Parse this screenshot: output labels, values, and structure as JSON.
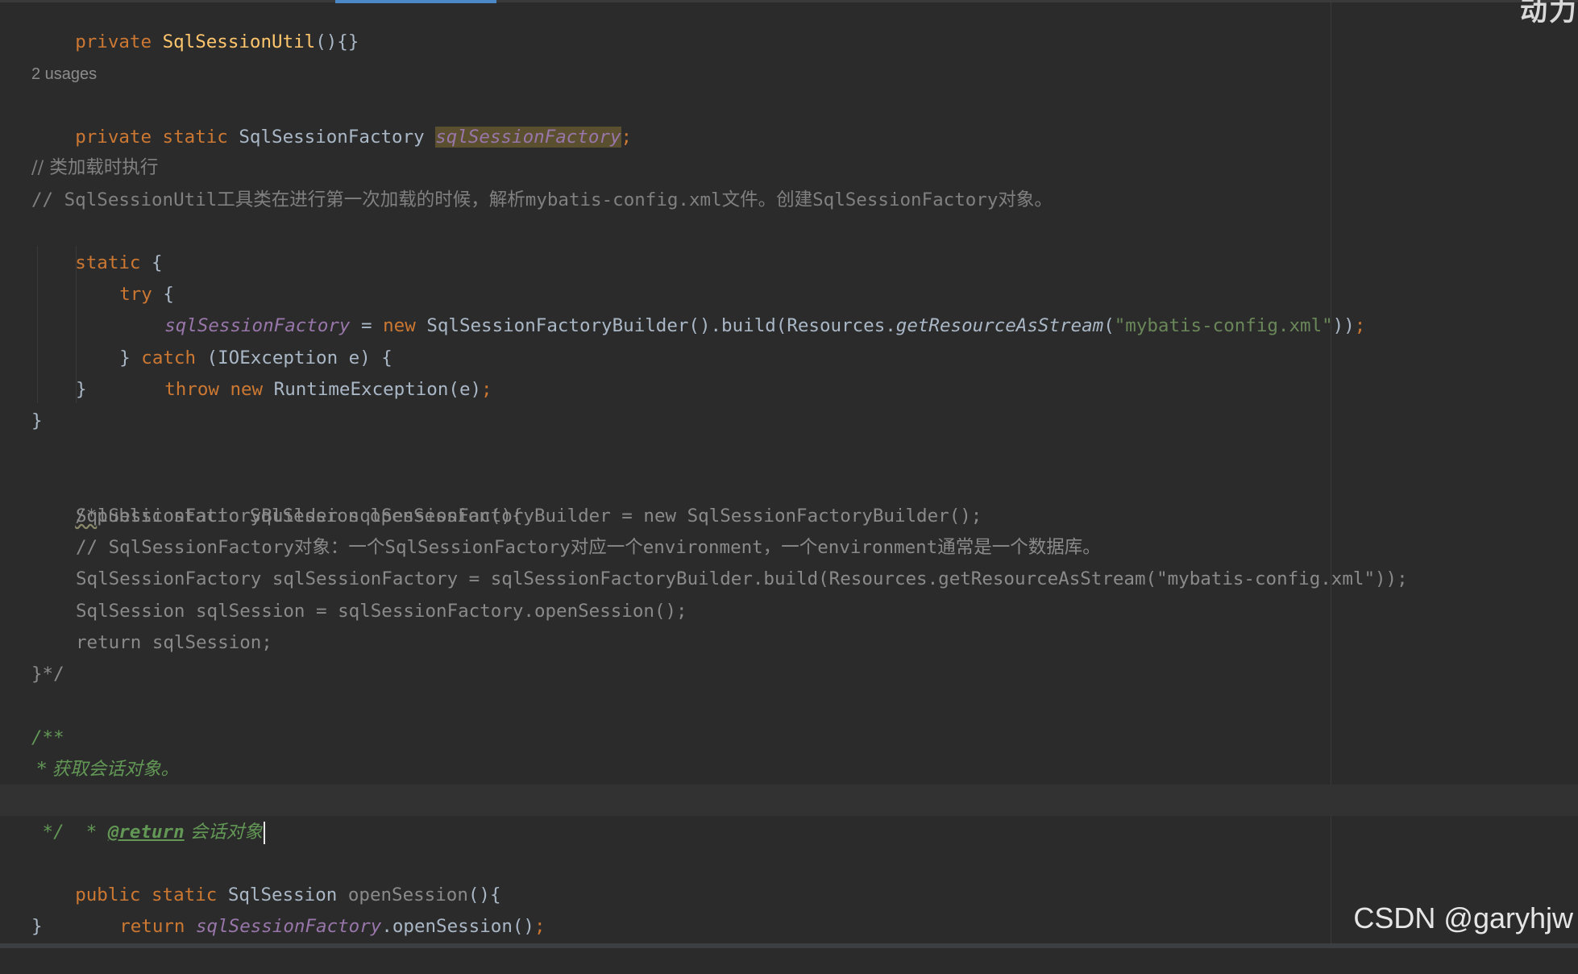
{
  "editor": {
    "corner_text": "动力",
    "usages_hint": "2 usages",
    "lines": {
      "l1": {
        "kw": "private ",
        "name": "SqlSessionUtil",
        "rest": "(){}"
      },
      "l2": {
        "kw": "private static ",
        "type": "SqlSessionFactory ",
        "field": "sqlSessionFactory",
        "semi": ";"
      },
      "l3": "// 类加载时执行",
      "l4": "// SqlSessionUtil工具类在进行第一次加载的时候，解析mybatis-config.xml文件。创建SqlSessionFactory对象。",
      "l5": {
        "kw": "static",
        "rest": " {"
      },
      "l6": {
        "kw": "try",
        "rest": " {"
      },
      "l7": {
        "field": "sqlSessionFactory",
        "eq": " = ",
        "kw": "new ",
        "call": "SqlSessionFactoryBuilder().build(Resources.",
        "static_call": "getResourceAsStream",
        "open": "(",
        "str": "\"mybatis-config.xml\"",
        "close": "))",
        "semi": ";"
      },
      "l8": {
        "pre": "} ",
        "kw": "catch",
        "rest": " (IOException e) {"
      },
      "l9": {
        "kw": "throw new ",
        "rest": "RuntimeException(e)",
        "semi": ";"
      },
      "l10": "}",
      "l11": "}",
      "l12a": "/*",
      "l12b": "public static SqlSession openSession(){",
      "l13": "SqlSessionFactoryBuilder sqlSessionFactoryBuilder = new SqlSessionFactoryBuilder();",
      "l14": "// SqlSessionFactory对象：一个SqlSessionFactory对应一个environment，一个environment通常是一个数据库。",
      "l15": "SqlSessionFactory sqlSessionFactory = sqlSessionFactoryBuilder.build(Resources.getResourceAsStream(\"mybatis-config.xml\"));",
      "l16": "SqlSession sqlSession = sqlSessionFactory.openSession();",
      "l17": "return sqlSession;",
      "l18": "}*/",
      "l19": "/**",
      "l20": " * 获取会话对象。",
      "l21": {
        "star": " * ",
        "tag": "@return",
        "text": " 会话对象"
      },
      "l22": " */",
      "l23": {
        "kw": "public static ",
        "type": "SqlSession ",
        "name": "openSession",
        "rest": "(){"
      },
      "l24": {
        "kw": "return ",
        "field": "sqlSessionFactory",
        "rest": ".openSession()",
        "semi": ";"
      },
      "l25": "}"
    }
  },
  "watermark": "CSDN @garyhjw",
  "colors": {
    "background": "#2b2b2b",
    "keyword": "#cc7832",
    "method_declaration": "#ffc66d",
    "static_field": "#9876aa",
    "string": "#6a8759",
    "comment": "#808080",
    "doc_comment": "#629755",
    "plain": "#a9b7c6",
    "current_line": "#323232",
    "tab_indicator": "#4a88c7"
  }
}
